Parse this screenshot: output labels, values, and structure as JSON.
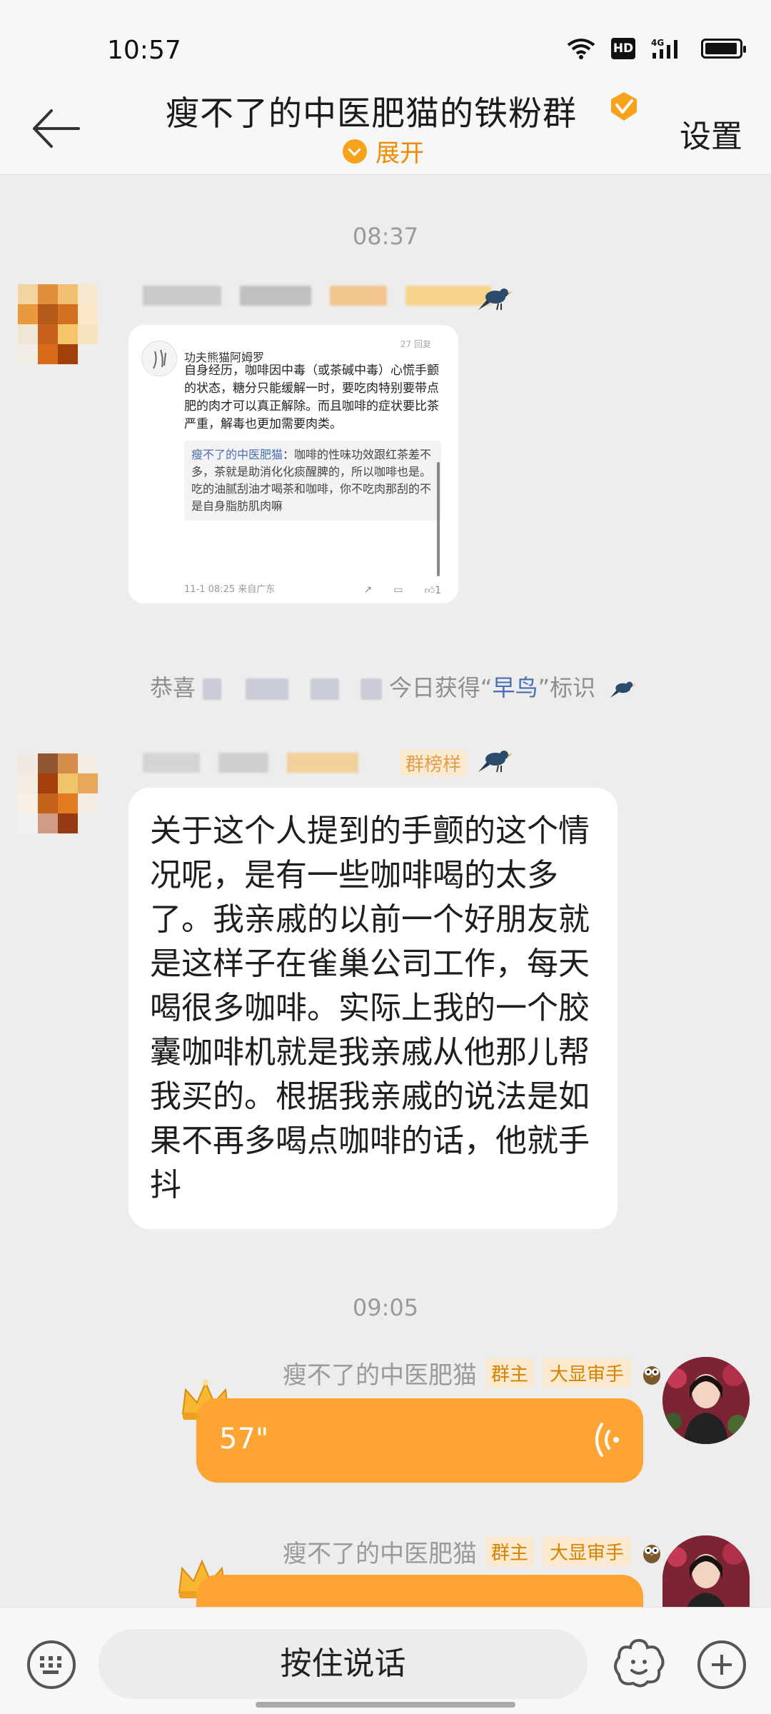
{
  "status_bar": {
    "time": "10:57",
    "net_label": "4G",
    "hd_label": "HD"
  },
  "header": {
    "title": "瘦不了的中医肥猫的铁粉群",
    "expand_label": "展开",
    "settings_label": "设置"
  },
  "timestamps": [
    "08:37",
    "09:05"
  ],
  "image_message": {
    "author": "功夫熊猫阿姆罗",
    "body": "自身经历，咖啡因中毒（或茶碱中毒）心慌手颤的状态，糖分只能缓解一时，要吃肉特别要带点肥的肉才可以真正解除。而且咖啡的症状要比茶严重，解毒也更加需要肉类。",
    "quote_name": "瘦不了的中医肥猫",
    "quote_body": "：咖啡的性味功效跟红茶差不多，茶就是助消化化痰醒脾的，所以咖啡也是。吃的油腻刮油才喝茶和咖啡，你不吃肉那刮的不是自身脂肪肌肉嘛",
    "footer": "11-1 08:25 来自广东",
    "like_count": "1",
    "top_meta": "27 回复"
  },
  "system_message": {
    "prefix": "恭喜",
    "middle": "今日获得“",
    "highlight": "早鸟",
    "suffix": "”标识"
  },
  "sender2_tag": "群榜样",
  "text_message": "关于这个人提到的手颤的这个情况呢，是有一些咖啡喝的太多了。我亲戚的以前一个好朋友就是这样子在雀巢公司工作，每天喝很多咖啡。实际上我的一个胶囊咖啡机就是我亲戚从他那儿帮我买的。根据我亲戚的说法是如果不再多喝点咖啡的话，他就手抖",
  "owner_messages": [
    {
      "sender": "瘦不了的中医肥猫",
      "tag_owner": "群主",
      "tag_title": "大显审手",
      "voice_duration": "57\""
    },
    {
      "sender": "瘦不了的中医肥猫",
      "tag_owner": "群主",
      "tag_title": "大显审手"
    }
  ],
  "input_bar": {
    "hold_to_talk": "按住说话"
  },
  "colors": {
    "accent": "#fea433",
    "tag_text": "#d38300",
    "link": "#4a6fb5"
  }
}
